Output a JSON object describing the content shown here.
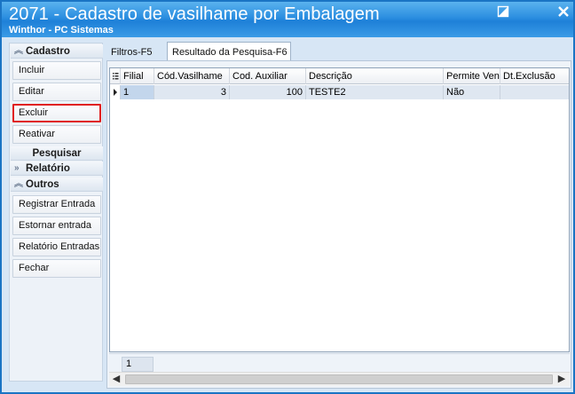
{
  "window": {
    "title": "2071 - Cadastro de vasilhame por Embalagem",
    "subtitle": "Winthor - PC Sistemas"
  },
  "sidebar": {
    "groups": [
      {
        "label": "Cadastro",
        "chevron": "collapse-up"
      },
      {
        "label": "Pesquisar",
        "chevron": ""
      },
      {
        "label": "Relatório",
        "chevron": "expand-right"
      },
      {
        "label": "Outros",
        "chevron": "collapse-up"
      }
    ],
    "cadastro_items": [
      "Incluir",
      "Editar",
      "Excluir",
      "Reativar"
    ],
    "outros_items": [
      "Registrar Entrada",
      "Estornar entrada",
      "Relatório Entradas",
      "Fechar"
    ]
  },
  "tabs": [
    {
      "label": "Filtros-F5",
      "active": false
    },
    {
      "label": "Resultado da Pesquisa-F6",
      "active": true
    }
  ],
  "grid": {
    "columns": [
      "Filial",
      "Cód.Vasilhame",
      "Cod. Auxiliar",
      "Descrição",
      "Permite Venda",
      "Dt.Exclusão"
    ],
    "rows": [
      [
        "1",
        "3",
        "100",
        "TESTE2",
        "Não",
        ""
      ]
    ],
    "row_count": "1"
  },
  "colors": {
    "titlebar": "#2b8ee0",
    "highlight_border": "#e02020",
    "selected_row": "#dfe7f1"
  },
  "icons": {
    "restore": "restore-icon",
    "close": "close-icon",
    "row_indicator": "row-pointer-icon"
  }
}
